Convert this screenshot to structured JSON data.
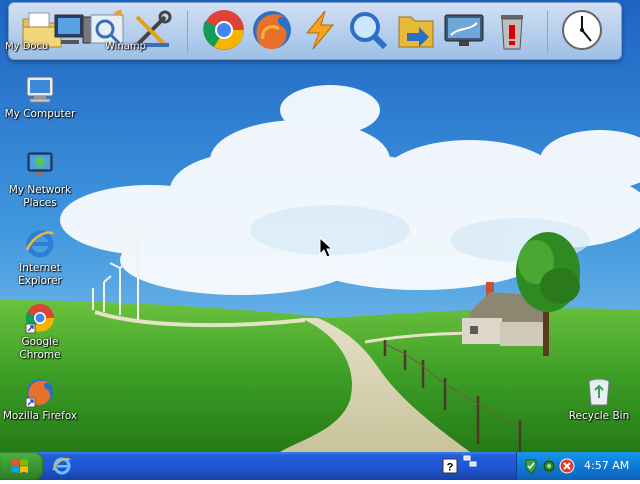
{
  "dock": {
    "items": [
      {
        "label": "My Documents",
        "icon": "folder-documents-icon"
      },
      {
        "label": "My Computer",
        "icon": "computer-icon"
      },
      {
        "label": "Winamp",
        "icon": "winamp-search-icon"
      },
      {
        "label": "Tools",
        "icon": "tools-icon"
      },
      {
        "label": "Google Chrome",
        "icon": "chrome-icon"
      },
      {
        "label": "Mozilla Firefox",
        "icon": "firefox-icon"
      },
      {
        "label": "Lightning",
        "icon": "lightning-icon"
      },
      {
        "label": "Search",
        "icon": "magnifier-icon"
      },
      {
        "label": "Folder",
        "icon": "folder-arrow-icon"
      },
      {
        "label": "Display",
        "icon": "monitor-icon"
      },
      {
        "label": "Recycle Bin",
        "icon": "trash-icon"
      },
      {
        "label": "Clock",
        "icon": "clock-icon"
      }
    ],
    "visible_labels": {
      "my_documents": "My Docu",
      "winamp": "Winamp"
    }
  },
  "desktop_icons": [
    {
      "label": "My Computer"
    },
    {
      "label": "My Network Places"
    },
    {
      "label": "Internet Explorer"
    },
    {
      "label": "Google Chrome"
    },
    {
      "label": "Mozilla Firefox"
    },
    {
      "label": "Recycle Bin"
    }
  ],
  "taskbar": {
    "clock": "4:57 AM",
    "tray_icons": [
      "help-icon",
      "network-icon",
      "green-shield-icon",
      "gear-icon",
      "red-x-icon"
    ]
  },
  "colors": {
    "taskbar": "#245edb",
    "start_green": "#3c9c34",
    "tray_blue": "#0f79d6",
    "sky": "#3b8fd8",
    "grass": "#3fa32a"
  }
}
